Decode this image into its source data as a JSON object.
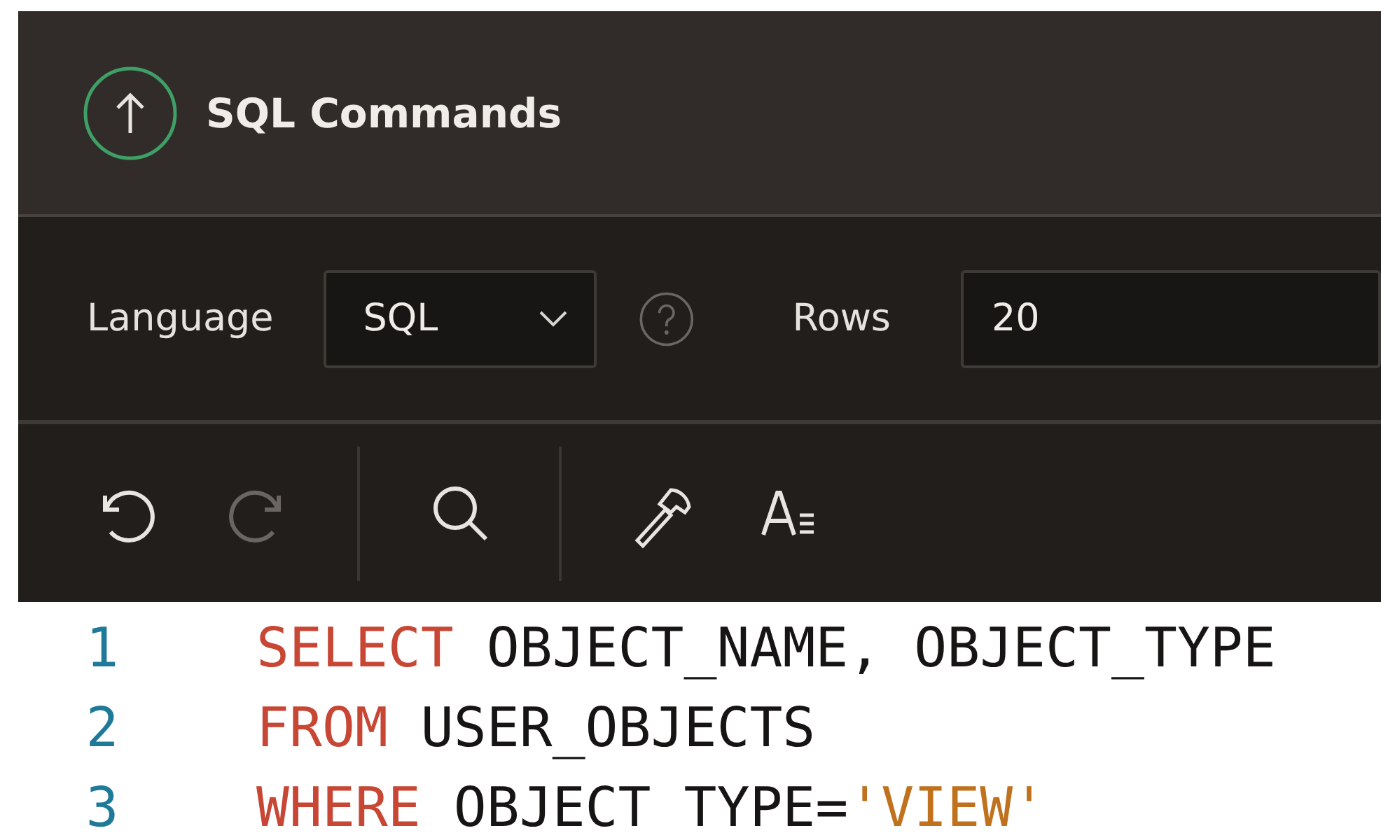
{
  "header": {
    "title": "SQL Commands"
  },
  "settings": {
    "language_label": "Language",
    "language": "SQL",
    "rows_label": "Rows",
    "rows": "20"
  },
  "editor_toolbar": [
    [
      {
        "kind": "undo",
        "disabled": false
      },
      {
        "kind": "redo",
        "disabled": true
      }
    ],
    [
      {
        "kind": "find",
        "disabled": false
      }
    ],
    [
      {
        "kind": "build",
        "disabled": false
      },
      {
        "kind": "format",
        "disabled": false
      }
    ]
  ],
  "code": [
    {
      "number": "1",
      "tokens": [
        {
          "kind": "keyword",
          "text": "SELECT"
        },
        {
          "kind": "plain",
          "text": " OBJECT_NAME, OBJECT_TYPE"
        }
      ]
    },
    {
      "number": "2",
      "tokens": [
        {
          "kind": "keyword",
          "text": "FROM"
        },
        {
          "kind": "plain",
          "text": " USER_OBJECTS"
        }
      ]
    },
    {
      "number": "3",
      "tokens": [
        {
          "kind": "keyword",
          "text": "WHERE"
        },
        {
          "kind": "plain",
          "text": " OBJECT_TYPE="
        },
        {
          "kind": "string",
          "text": "'VIEW'"
        }
      ]
    }
  ]
}
